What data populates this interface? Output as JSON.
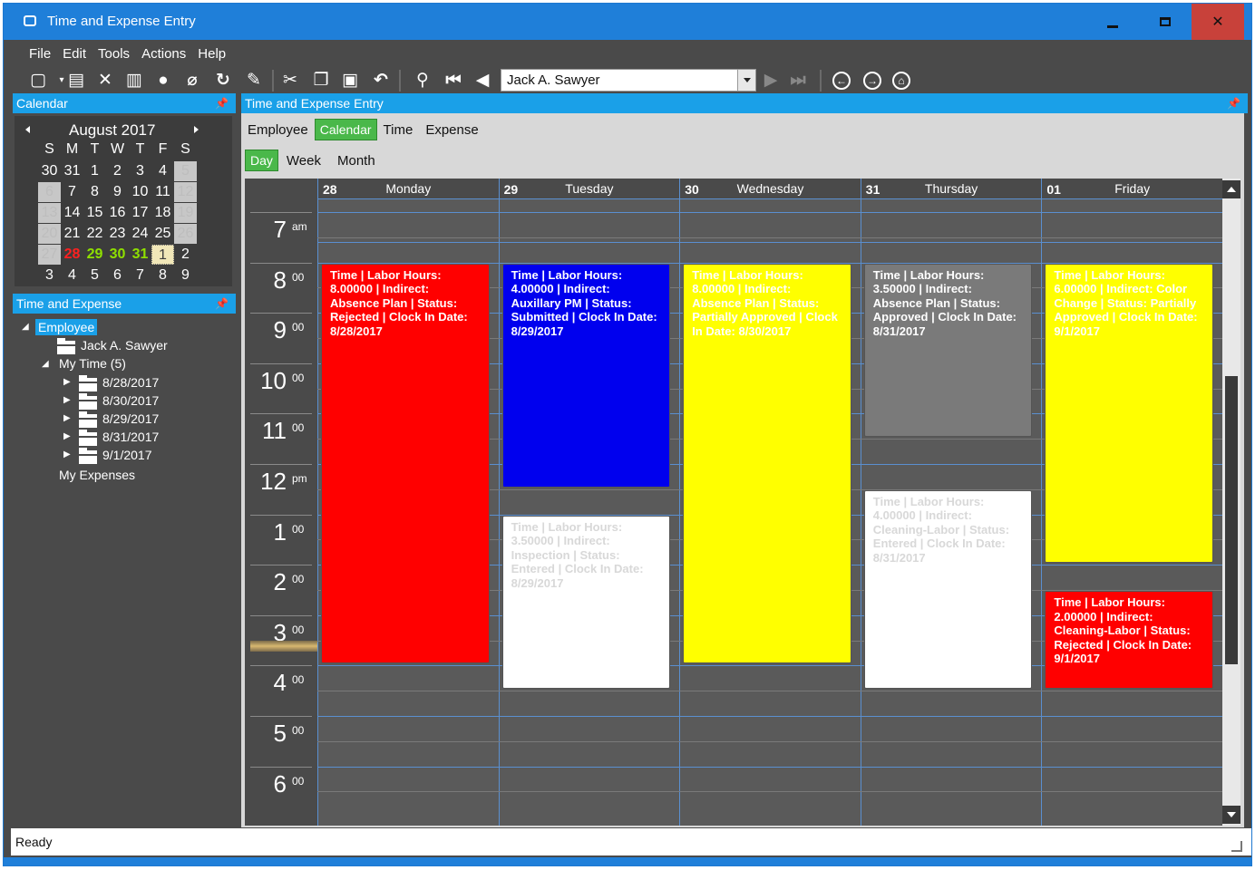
{
  "window": {
    "title": "Time and Expense Entry"
  },
  "menu": [
    "File",
    "Edit",
    "Tools",
    "Actions",
    "Help"
  ],
  "toolbar": {
    "employee_selected": "Jack A. Sawyer"
  },
  "calendar_panel": {
    "title": "Calendar",
    "month_label": "August 2017",
    "weekdays": [
      "S",
      "M",
      "T",
      "W",
      "T",
      "F",
      "S"
    ],
    "weeks": [
      [
        "30",
        "31",
        "1",
        "2",
        "3",
        "4",
        "5"
      ],
      [
        "6",
        "7",
        "8",
        "9",
        "10",
        "11",
        "12"
      ],
      [
        "13",
        "14",
        "15",
        "16",
        "17",
        "18",
        "19"
      ],
      [
        "20",
        "21",
        "22",
        "23",
        "24",
        "25",
        "26"
      ],
      [
        "27",
        "28",
        "29",
        "30",
        "31",
        "1",
        "2"
      ],
      [
        "3",
        "4",
        "5",
        "6",
        "7",
        "8",
        "9"
      ]
    ]
  },
  "tree_panel": {
    "title": "Time and Expense",
    "root": "Employee",
    "employee": "Jack A. Sawyer",
    "my_time": "My Time (5)",
    "dates": [
      "8/28/2017",
      "8/30/2017",
      "8/29/2017",
      "8/31/2017",
      "9/1/2017"
    ],
    "my_expenses": "My Expenses"
  },
  "main_panel": {
    "title": "Time and Expense Entry",
    "tabs": [
      "Employee",
      "Calendar",
      "Time",
      "Expense"
    ],
    "view_tabs": [
      "Day",
      "Week",
      "Month"
    ]
  },
  "schedule": {
    "days": [
      {
        "num": "28",
        "name": "Monday"
      },
      {
        "num": "29",
        "name": "Tuesday"
      },
      {
        "num": "30",
        "name": "Wednesday"
      },
      {
        "num": "31",
        "name": "Thursday"
      },
      {
        "num": "01",
        "name": "Friday"
      }
    ],
    "hours": [
      {
        "h": "7",
        "s": "am"
      },
      {
        "h": "8",
        "s": "00"
      },
      {
        "h": "9",
        "s": "00"
      },
      {
        "h": "10",
        "s": "00"
      },
      {
        "h": "11",
        "s": "00"
      },
      {
        "h": "12",
        "s": "pm"
      },
      {
        "h": "1",
        "s": "00"
      },
      {
        "h": "2",
        "s": "00"
      },
      {
        "h": "3",
        "s": "00"
      },
      {
        "h": "4",
        "s": "00"
      },
      {
        "h": "5",
        "s": "00"
      },
      {
        "h": "6",
        "s": "00"
      }
    ],
    "events": [
      {
        "day": 0,
        "start": 8.0,
        "end": 16.0,
        "color": "#ff0000",
        "text": "Time | Labor Hours: 8.00000 | Indirect: Absence Plan | Status: Rejected | Clock In Date: 8/28/2017"
      },
      {
        "day": 1,
        "start": 8.0,
        "end": 12.5,
        "color": "#0000ee",
        "text": "Time | Labor Hours: 4.00000 | Indirect: Auxillary PM | Status: Submitted | Clock In Date: 8/29/2017"
      },
      {
        "day": 1,
        "start": 13.0,
        "end": 16.5,
        "color": "#ffffff",
        "text": "Time | Labor Hours: 3.50000 | Indirect: Inspection | Status: Entered | Clock In Date: 8/29/2017"
      },
      {
        "day": 2,
        "start": 8.0,
        "end": 16.0,
        "color": "#ffff00",
        "text": "Time | Labor Hours: 8.00000 | Indirect: Absence Plan | Status: Partially Approved | Clock In Date: 8/30/2017"
      },
      {
        "day": 3,
        "start": 8.0,
        "end": 11.5,
        "color": "#7a7a7a",
        "text": "Time | Labor Hours: 3.50000 | Indirect: Absence Plan | Status: Approved | Clock In Date: 8/31/2017"
      },
      {
        "day": 3,
        "start": 12.5,
        "end": 16.5,
        "color": "#ffffff",
        "text": "Time | Labor Hours: 4.00000 | Indirect: Cleaning-Labor | Status: Entered | Clock In Date: 8/31/2017"
      },
      {
        "day": 4,
        "start": 8.0,
        "end": 14.0,
        "color": "#ffff00",
        "text": "Time | Labor Hours: 6.00000 | Indirect: Color Change | Status: Partially Approved | Clock In Date: 9/1/2017"
      },
      {
        "day": 4,
        "start": 14.5,
        "end": 16.5,
        "color": "#ff0000",
        "text": "Time | Labor Hours: 2.00000 | Indirect: Cleaning-Labor | Status: Rejected | Clock In Date: 9/1/2017"
      }
    ]
  },
  "status": "Ready",
  "colors": {
    "accent": "#1f7fd9",
    "panel_header": "#1aa0e8",
    "active_tab": "#4ab84a",
    "background": "#4a4a4a"
  }
}
